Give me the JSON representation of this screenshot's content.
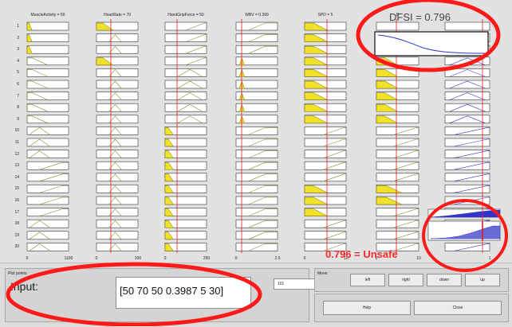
{
  "window": {
    "title": "Rule Viewer"
  },
  "columns": [
    {
      "title": "MuscleActivity = 50",
      "ticks": [
        "0",
        "1100"
      ]
    },
    {
      "title": "HeartRate = 70",
      "ticks": [
        "0",
        "200"
      ]
    },
    {
      "title": "HandGripForce = 50",
      "ticks": [
        "0",
        "250"
      ]
    },
    {
      "title": "WBV = 0.399",
      "ticks": [
        "0",
        "2.5"
      ]
    },
    {
      "title": "SPD = 5",
      "ticks": [
        "0",
        "10"
      ]
    },
    {
      "title": "D",
      "ticks": [
        "0",
        "10"
      ]
    },
    {
      "title": "",
      "ticks": [
        "",
        "1"
      ]
    }
  ],
  "rows": [
    "1",
    "2",
    "3",
    "4",
    "5",
    "6",
    "7",
    "8",
    "9",
    "10",
    "11",
    "12",
    "13",
    "14",
    "15",
    "16",
    "17",
    "18",
    "19",
    "20"
  ],
  "annotations": {
    "dfsi": "DFSI = 0.796",
    "verdict": "0.796 = Unsafe"
  },
  "input": {
    "label": "Input:",
    "value": "[50 70 50 0.3987 5 30]",
    "small_label": "Plot points:",
    "plot_points": "101"
  },
  "move": {
    "label": "Move:",
    "left": "left",
    "right": "right",
    "down": "down",
    "up": "up"
  },
  "actions": {
    "help": "Help",
    "close": "Close"
  },
  "colors": {
    "fill": "#f0e22a",
    "red_line": "#e21c1c",
    "blue": "#3333cc",
    "annotation": "#ff1a1a"
  }
}
